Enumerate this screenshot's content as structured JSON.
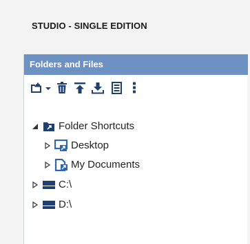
{
  "app": {
    "title": "STUDIO - SINGLE EDITION"
  },
  "panel": {
    "header": "Folders and Files",
    "toolbar": {
      "items": [
        {
          "icon": "add-folder-icon"
        },
        {
          "icon": "dropdown-arrow-icon"
        },
        {
          "icon": "trash-icon"
        },
        {
          "icon": "upload-icon"
        },
        {
          "icon": "download-icon"
        },
        {
          "icon": "list-icon"
        },
        {
          "icon": "more-vertical-icon"
        }
      ]
    }
  },
  "tree": {
    "folder_shortcuts": {
      "label": "Folder Shortcuts",
      "expanded": true
    },
    "desktop": {
      "label": "Desktop",
      "expanded": false
    },
    "my_documents": {
      "label": "My Documents",
      "expanded": false
    },
    "drive_c": {
      "label": "C:\\",
      "expanded": false
    },
    "drive_d": {
      "label": "D:\\",
      "expanded": false
    }
  },
  "colors": {
    "header_bg": "#6e91c4",
    "icon_dark": "#1f3f6e",
    "icon_blue": "#2f66b3",
    "panel_bg": "#ffffff",
    "app_bg": "#f3f3f3"
  }
}
